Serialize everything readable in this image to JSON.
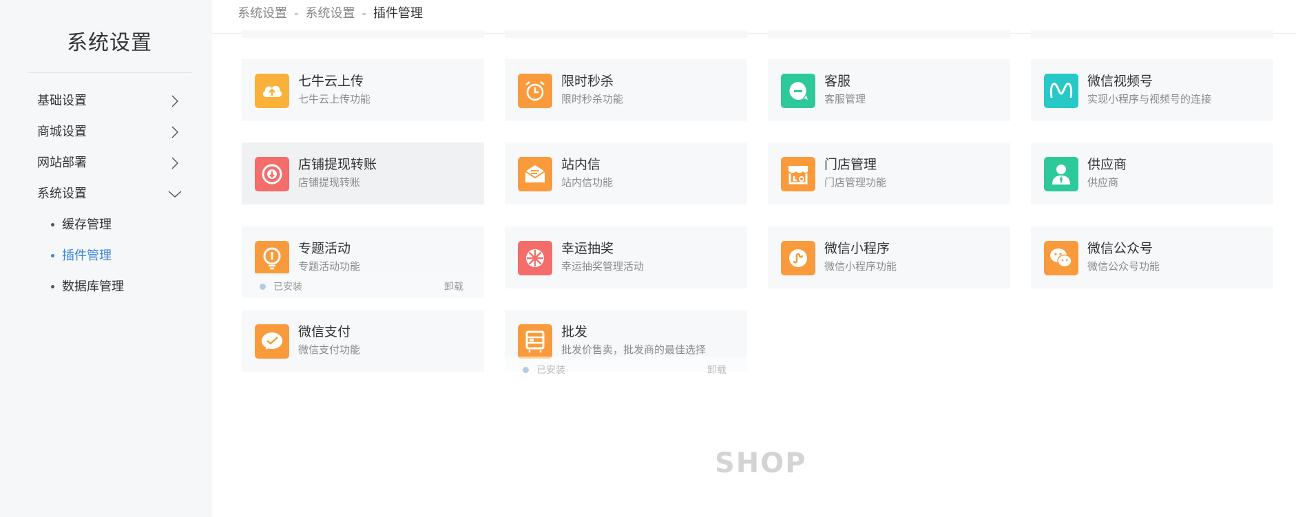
{
  "sidebar": {
    "title": "系统设置",
    "items": [
      {
        "label": "基础设置",
        "expanded": false
      },
      {
        "label": "商城设置",
        "expanded": false
      },
      {
        "label": "网站部署",
        "expanded": false
      },
      {
        "label": "系统设置",
        "expanded": true
      }
    ],
    "sub_items": [
      {
        "label": "缓存管理",
        "active": false
      },
      {
        "label": "插件管理",
        "active": true
      },
      {
        "label": "数据库管理",
        "active": false
      }
    ]
  },
  "breadcrumb": [
    "系统设置",
    "系统设置",
    "插件管理"
  ],
  "breadcrumb_separator": "-",
  "plugins": [
    {
      "name": "七牛云上传",
      "desc": "七牛云上传功能",
      "icon": "cloud-upload-icon",
      "color": "#f9b13a"
    },
    {
      "name": "限时秒杀",
      "desc": "限时秒杀功能",
      "icon": "alarm-clock-icon",
      "color": "#f99b3c"
    },
    {
      "name": "客服",
      "desc": "客服管理",
      "icon": "chat-bubble-icon",
      "color": "#2ec99a"
    },
    {
      "name": "微信视频号",
      "desc": "实现小程序与视频号的连接",
      "icon": "video-channel-icon",
      "color": "#26c9c8"
    },
    {
      "name": "店铺提现转账",
      "desc": "店铺提现转账",
      "icon": "withdraw-icon",
      "color": "#f56d6a"
    },
    {
      "name": "站内信",
      "desc": "站内信功能",
      "icon": "mail-icon",
      "color": "#f99b3c"
    },
    {
      "name": "门店管理",
      "desc": "门店管理功能",
      "icon": "store-icon",
      "color": "#f99b3c"
    },
    {
      "name": "供应商",
      "desc": "供应商",
      "icon": "supplier-icon",
      "color": "#2ec99a"
    },
    {
      "name": "专题活动",
      "desc": "专题活动功能",
      "icon": "lightbulb-icon",
      "color": "#f99b3c"
    },
    {
      "name": "幸运抽奖",
      "desc": "幸运抽奖管理活动",
      "icon": "prize-wheel-icon",
      "color": "#f56d6a"
    },
    {
      "name": "微信小程序",
      "desc": "微信小程序功能",
      "icon": "mini-program-icon",
      "color": "#f99b3c"
    },
    {
      "name": "微信公众号",
      "desc": "微信公众号功能",
      "icon": "wechat-icon",
      "color": "#f99b3c"
    },
    {
      "name": "微信支付",
      "desc": "微信支付功能",
      "icon": "wechat-pay-icon",
      "color": "#f99b3c"
    },
    {
      "name": "批发",
      "desc": "批发价售卖，批发商的最佳选择",
      "icon": "wholesale-icon",
      "color": "#f99b3c"
    }
  ],
  "status": {
    "installed": "已安装",
    "uninstall": "卸载"
  },
  "watermark": "SHOP",
  "colors": {
    "accent": "#3a86d6",
    "sidebar_bg": "#f6f7f9",
    "card_bg": "#f7f8fa"
  }
}
